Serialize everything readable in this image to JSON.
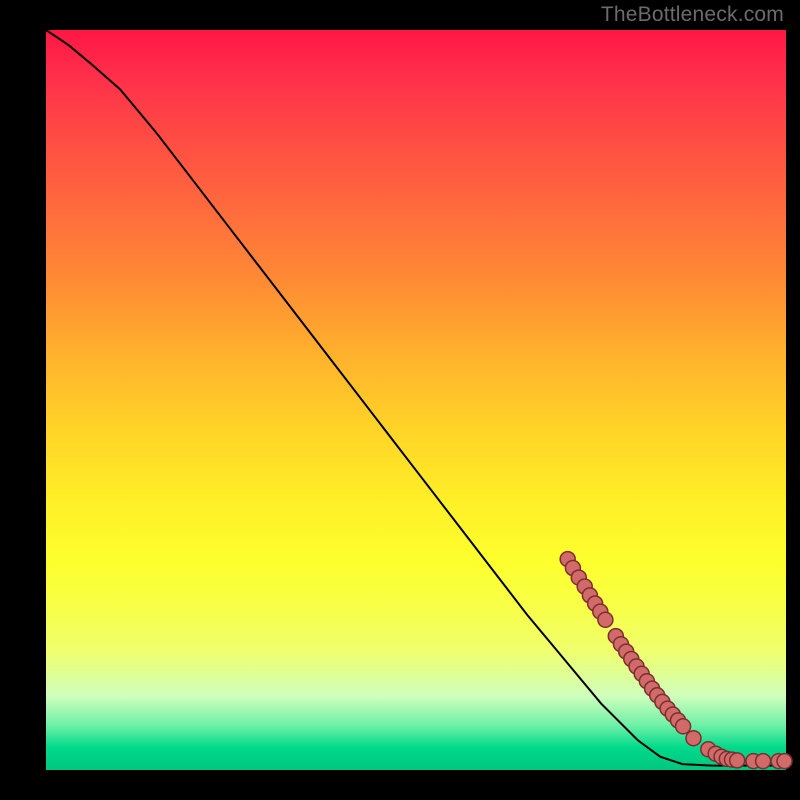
{
  "watermark": "TheBottleneck.com",
  "colors": {
    "dot_fill": "#d36a6a",
    "dot_stroke": "#7a2f2f",
    "curve": "#000000",
    "frame": "#000000"
  },
  "chart_data": {
    "type": "line",
    "title": "",
    "xlabel": "",
    "ylabel": "",
    "xlim": [
      0,
      100
    ],
    "ylim": [
      0,
      100
    ],
    "grid": false,
    "curve": [
      {
        "x": 0,
        "y": 100
      },
      {
        "x": 3,
        "y": 98
      },
      {
        "x": 6,
        "y": 95.5
      },
      {
        "x": 10,
        "y": 92
      },
      {
        "x": 15,
        "y": 86
      },
      {
        "x": 20,
        "y": 79.5
      },
      {
        "x": 25,
        "y": 73
      },
      {
        "x": 30,
        "y": 66.5
      },
      {
        "x": 35,
        "y": 60
      },
      {
        "x": 40,
        "y": 53.5
      },
      {
        "x": 45,
        "y": 47
      },
      {
        "x": 50,
        "y": 40.5
      },
      {
        "x": 55,
        "y": 34
      },
      {
        "x": 60,
        "y": 27.5
      },
      {
        "x": 65,
        "y": 21
      },
      {
        "x": 70,
        "y": 15
      },
      {
        "x": 75,
        "y": 9
      },
      {
        "x": 80,
        "y": 4
      },
      {
        "x": 83,
        "y": 1.8
      },
      {
        "x": 86,
        "y": 0.8
      },
      {
        "x": 90,
        "y": 0.6
      },
      {
        "x": 95,
        "y": 0.6
      },
      {
        "x": 100,
        "y": 0.6
      }
    ],
    "series": [
      {
        "name": "points",
        "type": "scatter",
        "points": [
          {
            "x": 70.5,
            "y": 28.5
          },
          {
            "x": 71.2,
            "y": 27.3
          },
          {
            "x": 72.0,
            "y": 26.0
          },
          {
            "x": 72.8,
            "y": 24.8
          },
          {
            "x": 73.5,
            "y": 23.6
          },
          {
            "x": 74.2,
            "y": 22.5
          },
          {
            "x": 74.9,
            "y": 21.4
          },
          {
            "x": 75.6,
            "y": 20.3
          },
          {
            "x": 77.0,
            "y": 18.1
          },
          {
            "x": 77.7,
            "y": 17.0
          },
          {
            "x": 78.4,
            "y": 16.0
          },
          {
            "x": 79.1,
            "y": 15.0
          },
          {
            "x": 79.8,
            "y": 14.0
          },
          {
            "x": 80.5,
            "y": 13.0
          },
          {
            "x": 81.2,
            "y": 12.0
          },
          {
            "x": 81.9,
            "y": 11.0
          },
          {
            "x": 82.6,
            "y": 10.1
          },
          {
            "x": 83.3,
            "y": 9.2
          },
          {
            "x": 84.0,
            "y": 8.3
          },
          {
            "x": 84.7,
            "y": 7.5
          },
          {
            "x": 85.4,
            "y": 6.7
          },
          {
            "x": 86.1,
            "y": 5.9
          },
          {
            "x": 87.5,
            "y": 4.3
          },
          {
            "x": 89.5,
            "y": 2.8
          },
          {
            "x": 90.5,
            "y": 2.2
          },
          {
            "x": 91.3,
            "y": 1.8
          },
          {
            "x": 92.0,
            "y": 1.5
          },
          {
            "x": 92.7,
            "y": 1.4
          },
          {
            "x": 93.4,
            "y": 1.3
          },
          {
            "x": 95.6,
            "y": 1.2
          },
          {
            "x": 96.9,
            "y": 1.2
          },
          {
            "x": 99.0,
            "y": 1.2
          },
          {
            "x": 99.8,
            "y": 1.2
          }
        ]
      }
    ]
  }
}
